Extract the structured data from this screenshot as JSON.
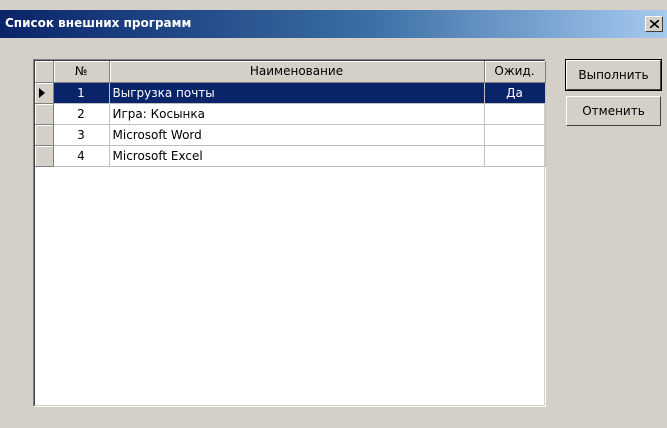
{
  "window": {
    "title": "Список внешних программ",
    "close_symbol": "✕"
  },
  "grid": {
    "columns": [
      "№",
      "Наименование",
      "Ожид."
    ],
    "rows": [
      {
        "num": "1",
        "name": "Выгрузка почты",
        "wait": "Да",
        "selected": true
      },
      {
        "num": "2",
        "name": "Игра: Косынка",
        "wait": "",
        "selected": false
      },
      {
        "num": "3",
        "name": "Microsoft Word",
        "wait": "",
        "selected": false
      },
      {
        "num": "4",
        "name": "Microsoft Excel",
        "wait": "",
        "selected": false
      }
    ]
  },
  "buttons": {
    "run_label": "Выполнить",
    "cancel_label": "Отменить"
  },
  "colors": {
    "selection": "#0a246a",
    "titlebar_start": "#0a246a",
    "titlebar_end": "#a6caf0",
    "face": "#d4d0c8"
  }
}
